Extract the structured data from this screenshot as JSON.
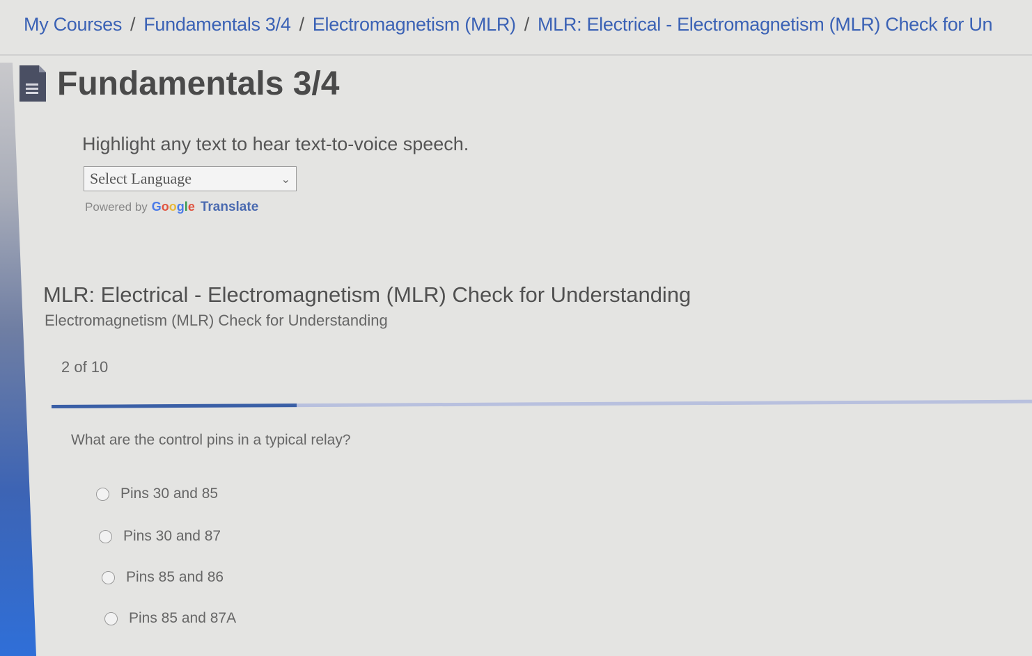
{
  "breadcrumb": {
    "items": [
      "My Courses",
      "Fundamentals 3/4",
      "Electromagnetism (MLR)",
      "MLR: Electrical - Electromagnetism (MLR) Check for Un"
    ],
    "separator": "/"
  },
  "header": {
    "icon": "document-icon",
    "title": "Fundamentals 3/4"
  },
  "translate": {
    "note": "Highlight any text to hear text-to-voice speech.",
    "select_value": "Select Language",
    "powered_by": "Powered by",
    "google_letters": [
      "G",
      "o",
      "o",
      "g",
      "l",
      "e"
    ],
    "translate_label": "Translate"
  },
  "quiz": {
    "title": "MLR: Electrical - Electromagnetism (MLR) Check for Understanding",
    "subtitle": "Electromagnetism (MLR) Check for Understanding",
    "progress_text": "2 of 10",
    "progress_fraction": 0.25,
    "question": "What are the control pins in a typical relay?",
    "options": [
      "Pins 30 and 85",
      "Pins 30 and 87",
      "Pins 85 and 86",
      "Pins 85 and 87A"
    ]
  },
  "colors": {
    "link": "#3b62b5",
    "progress_fill": "#3a5fa6",
    "progress_track": "#b8c0de"
  }
}
